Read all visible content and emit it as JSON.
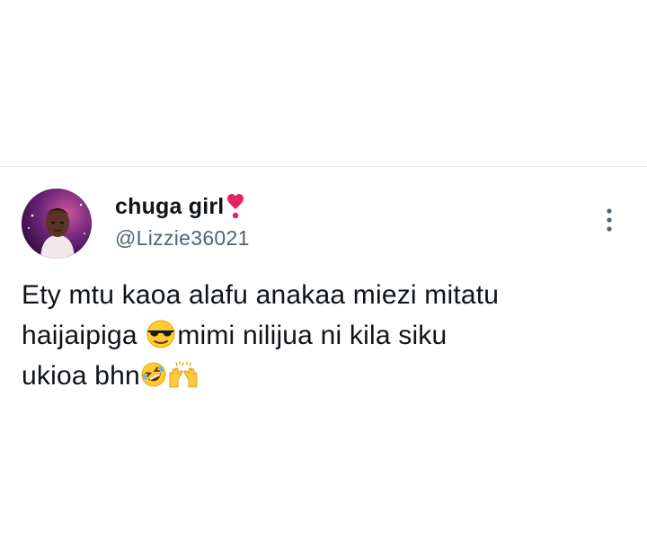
{
  "tweet": {
    "display_name": "chuga girl",
    "name_emoji": "heart-exclamation-icon",
    "handle": "@Lizzie36021",
    "more_icon": "more-vertical-icon",
    "text": {
      "line1": "Ety mtu kaoa alafu anakaa miezi mitatu",
      "line2_a": "haijaipiga ",
      "line2_b": "mimi nilijua ni kila siku",
      "line3_a": "ukioa bhn"
    },
    "emojis": [
      "sunglasses-face-icon",
      "rolling-laughing-face-icon",
      "raising-hands-icon"
    ]
  },
  "colors": {
    "text_primary": "#0f1419",
    "text_secondary": "#536471",
    "divider": "#e6e6e6",
    "heart": "#e0245e"
  }
}
